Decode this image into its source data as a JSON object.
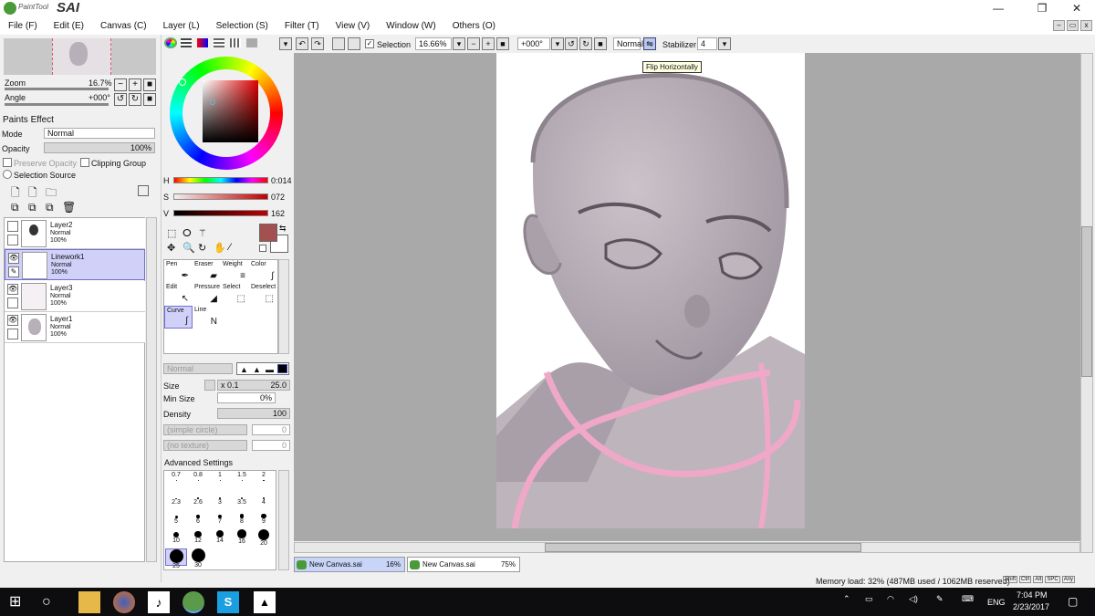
{
  "app": {
    "brand_small": "PaintTool",
    "brand_big": "SAI"
  },
  "window_controls": {
    "minimize": "—",
    "restore": "❐",
    "close": "✕"
  },
  "menu": [
    "File (F)",
    "Edit (E)",
    "Canvas (C)",
    "Layer (L)",
    "Selection (S)",
    "Filter (T)",
    "View (V)",
    "Window (W)",
    "Others (O)"
  ],
  "navigator": {
    "zoom_label": "Zoom",
    "zoom_value": "16.7%",
    "angle_label": "Angle",
    "angle_value": "+000°"
  },
  "paint_effect": {
    "header": "Paints Effect",
    "mode_label": "Mode",
    "mode_value": "Normal",
    "opacity_label": "Opacity",
    "opacity_value": "100%",
    "preserve_opacity": "Preserve Opacity",
    "clipping_group": "Clipping Group",
    "selection_source": "Selection Source"
  },
  "layers": [
    {
      "name": "Layer2",
      "mode": "Normal",
      "opacity": "100%",
      "active": false
    },
    {
      "name": "Linework1",
      "mode": "Normal",
      "opacity": "100%",
      "active": true
    },
    {
      "name": "Layer3",
      "mode": "Normal",
      "opacity": "100%",
      "active": false
    },
    {
      "name": "Layer1",
      "mode": "Normal",
      "opacity": "100%",
      "active": false
    }
  ],
  "color": {
    "h_label": "H",
    "h_value": "0:014",
    "s_label": "S",
    "s_value": "072",
    "v_label": "V",
    "v_value": "162",
    "foreground": "#a35050"
  },
  "tools": [
    {
      "label": "Pen",
      "icon": "✒"
    },
    {
      "label": "Eraser",
      "icon": "▰"
    },
    {
      "label": "Weight",
      "icon": "≡"
    },
    {
      "label": "Color",
      "icon": "∫"
    },
    {
      "label": "Edit",
      "icon": "↖"
    },
    {
      "label": "Pressure",
      "icon": "◢"
    },
    {
      "label": "Select",
      "icon": "⬚"
    },
    {
      "label": "Deselect",
      "icon": "⬚"
    },
    {
      "label": "Curve",
      "icon": "∫"
    },
    {
      "label": "Line",
      "icon": "N"
    }
  ],
  "brush": {
    "blend_mode": "Normal",
    "size_label": "Size",
    "size_mult": "x 0.1",
    "size_value": "25.0",
    "min_size_label": "Min Size",
    "min_size_value": "0%",
    "density_label": "Density",
    "density_value": "100",
    "shape": "(simple circle)",
    "shape_value": "0",
    "texture": "(no texture)",
    "texture_value": "0",
    "advanced": "Advanced Settings",
    "sizes": [
      "0.7",
      "0.8",
      "1",
      "1.5",
      "2",
      "2.3",
      "2.6",
      "3",
      "3.5",
      "4",
      "5",
      "6",
      "7",
      "8",
      "9",
      "10",
      "12",
      "14",
      "16",
      "20",
      "25",
      "30"
    ]
  },
  "canvas_toolbar": {
    "selection_label": "Selection",
    "zoom": "16.66%",
    "angle": "+000°",
    "blend": "Normal",
    "stabilizer_label": "Stabilizer",
    "stabilizer_value": "4"
  },
  "tooltip": "Flip Horizontally",
  "doc_tabs": [
    {
      "name": "New Canvas.sai",
      "zoom": "16%"
    },
    {
      "name": "New Canvas.sai",
      "zoom": "75%"
    }
  ],
  "status": {
    "memory": "Memory load: 32% (487MB used / 1062MB reserved)",
    "keys": [
      "Shift",
      "Ctrl",
      "Alt",
      "SPC",
      "Any"
    ]
  },
  "taskbar": {
    "lang": "ENG",
    "time": "7:04 PM",
    "date": "2/23/2017"
  }
}
